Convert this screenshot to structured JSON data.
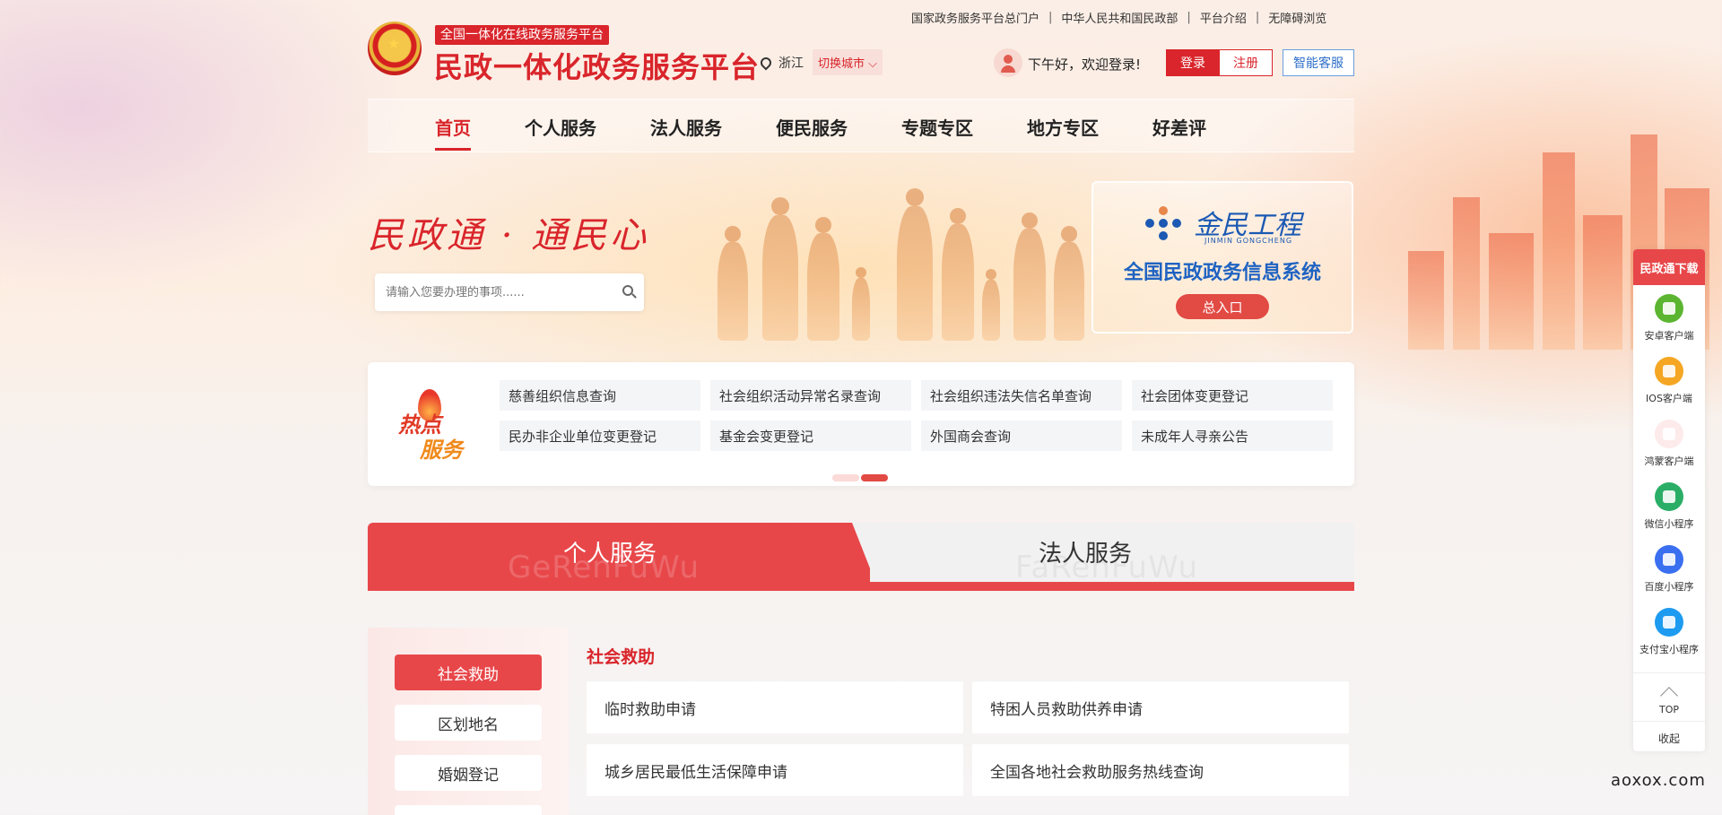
{
  "top_links": [
    "国家政务服务平台总门户",
    "中华人民共和国民政部",
    "平台介绍",
    "无障碍浏览"
  ],
  "header": {
    "subtitle": "全国一体化在线政务服务平台",
    "title": "民政一体化政务服务平台",
    "location": "浙江",
    "switch_city": "切换城市",
    "greeting": "下午好，欢迎登录!",
    "login": "登录",
    "register": "注册",
    "smart_service": "智能客服"
  },
  "nav": [
    "首页",
    "个人服务",
    "法人服务",
    "便民服务",
    "专题专区",
    "地方专区",
    "好差评"
  ],
  "banner": {
    "slogan": "民政通 · 通民心",
    "search_placeholder": "请输入您要办理的事项......",
    "jinmin_logo": "金民工程",
    "jinmin_en": "JINMIN GONGCHENG",
    "system_title": "全国民政政务信息系统",
    "entry": "总入口"
  },
  "hot": {
    "label_1": "热点",
    "label_2": "服务",
    "items": [
      "慈善组织信息查询",
      "社会组织活动异常名录查询",
      "社会组织违法失信名单查询",
      "社会团体变更登记",
      "民办非企业单位变更登记",
      "基金会变更登记",
      "外国商会查询",
      "未成年人寻亲公告"
    ]
  },
  "tabs": {
    "personal": "个人服务",
    "personal_ghost": "GeRenFuWu",
    "legal": "法人服务",
    "legal_ghost": "FaRenFuWu"
  },
  "categories": [
    "社会救助",
    "区划地名",
    "婚姻登记"
  ],
  "section": {
    "heading": "社会救助",
    "services": [
      "临时救助申请",
      "特困人员救助供养申请",
      "城乡居民最低生活保障申请",
      "全国各地社会救助服务热线查询"
    ]
  },
  "float": {
    "head": "民政通下载",
    "items": [
      {
        "label": "安卓客户端",
        "icon": "android-icon",
        "color": "#5cb531"
      },
      {
        "label": "IOS客户端",
        "icon": "apple-icon",
        "color": "#f5a623"
      },
      {
        "label": "鸿蒙客户端",
        "icon": "huawei-icon",
        "color": "#e8474a"
      },
      {
        "label": "微信小程序",
        "icon": "wechat-mini-icon",
        "color": "#2aae67"
      },
      {
        "label": "百度小程序",
        "icon": "baidu-mini-icon",
        "color": "#3a6ff0"
      },
      {
        "label": "支付宝小程序",
        "icon": "alipay-mini-icon",
        "color": "#1d9bf0"
      }
    ],
    "top": "TOP",
    "collapse": "收起"
  },
  "watermark": "aoxox.com",
  "colors": {
    "brand_red": "#d9252b",
    "tab_red": "#e8474a",
    "jinmin_blue": "#1f63c2"
  }
}
